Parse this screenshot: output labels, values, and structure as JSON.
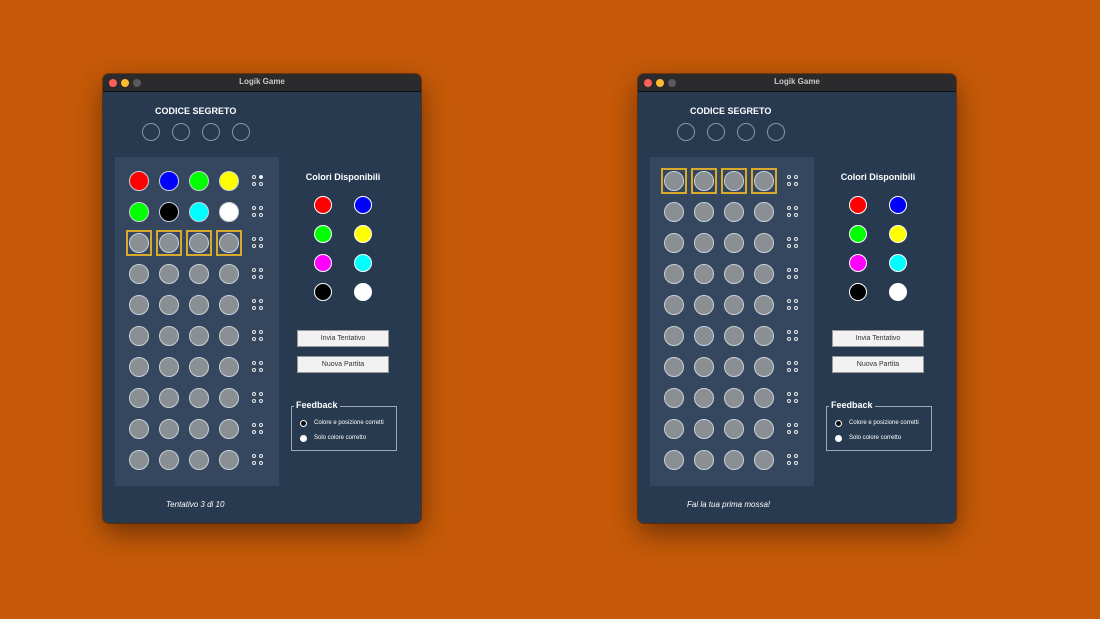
{
  "colors": {
    "hole": "#8a8f93",
    "red": "#ff0000",
    "blue": "#0000ff",
    "green": "#00ff00",
    "yellow": "#ffff00",
    "black": "#000000",
    "cyan": "#00ffff",
    "white": "#ffffff",
    "magenta": "#ff00ff",
    "selection": "#d8a92a"
  },
  "windows": [
    {
      "title": "Logik Game",
      "secret_label": "CODICE SEGRETO",
      "available_title": "Colori Disponibili",
      "available_colors": [
        "red",
        "blue",
        "green",
        "yellow",
        "magenta",
        "cyan",
        "black",
        "white"
      ],
      "buttons": {
        "submit": "Invia Tentativo",
        "new_game": "Nuova Partita"
      },
      "feedback": {
        "legend": "Feedback",
        "exact": "Colore e posizione corretti",
        "color_only": "Solo colore corretto"
      },
      "status": "Tentativo 3 di 10",
      "active_row": 2,
      "rows": [
        {
          "pegs": [
            "red",
            "blue",
            "green",
            "yellow"
          ],
          "feedback": [
            "empty",
            "white",
            "empty",
            "empty"
          ]
        },
        {
          "pegs": [
            "green",
            "black",
            "cyan",
            "white"
          ],
          "feedback": [
            "empty",
            "empty",
            "empty",
            "empty"
          ]
        },
        {
          "pegs": [
            "hole",
            "hole",
            "hole",
            "hole"
          ],
          "feedback": [
            "empty",
            "empty",
            "empty",
            "empty"
          ]
        },
        {
          "pegs": [
            "hole",
            "hole",
            "hole",
            "hole"
          ],
          "feedback": [
            "empty",
            "empty",
            "empty",
            "empty"
          ]
        },
        {
          "pegs": [
            "hole",
            "hole",
            "hole",
            "hole"
          ],
          "feedback": [
            "empty",
            "empty",
            "empty",
            "empty"
          ]
        },
        {
          "pegs": [
            "hole",
            "hole",
            "hole",
            "hole"
          ],
          "feedback": [
            "empty",
            "empty",
            "empty",
            "empty"
          ]
        },
        {
          "pegs": [
            "hole",
            "hole",
            "hole",
            "hole"
          ],
          "feedback": [
            "empty",
            "empty",
            "empty",
            "empty"
          ]
        },
        {
          "pegs": [
            "hole",
            "hole",
            "hole",
            "hole"
          ],
          "feedback": [
            "empty",
            "empty",
            "empty",
            "empty"
          ]
        },
        {
          "pegs": [
            "hole",
            "hole",
            "hole",
            "hole"
          ],
          "feedback": [
            "empty",
            "empty",
            "empty",
            "empty"
          ]
        },
        {
          "pegs": [
            "hole",
            "hole",
            "hole",
            "hole"
          ],
          "feedback": [
            "empty",
            "empty",
            "empty",
            "empty"
          ]
        }
      ]
    },
    {
      "title": "Logik Game",
      "secret_label": "CODICE SEGRETO",
      "available_title": "Colori Disponibili",
      "available_colors": [
        "red",
        "blue",
        "green",
        "yellow",
        "magenta",
        "cyan",
        "black",
        "white"
      ],
      "buttons": {
        "submit": "Invia Tentativo",
        "new_game": "Nuova Partita"
      },
      "feedback": {
        "legend": "Feedback",
        "exact": "Colore e posizione corretti",
        "color_only": "Solo colore corretto"
      },
      "status": "Fai la tua prima mossa!",
      "active_row": 0,
      "rows": [
        {
          "pegs": [
            "hole",
            "hole",
            "hole",
            "hole"
          ],
          "feedback": [
            "empty",
            "empty",
            "empty",
            "empty"
          ]
        },
        {
          "pegs": [
            "hole",
            "hole",
            "hole",
            "hole"
          ],
          "feedback": [
            "empty",
            "empty",
            "empty",
            "empty"
          ]
        },
        {
          "pegs": [
            "hole",
            "hole",
            "hole",
            "hole"
          ],
          "feedback": [
            "empty",
            "empty",
            "empty",
            "empty"
          ]
        },
        {
          "pegs": [
            "hole",
            "hole",
            "hole",
            "hole"
          ],
          "feedback": [
            "empty",
            "empty",
            "empty",
            "empty"
          ]
        },
        {
          "pegs": [
            "hole",
            "hole",
            "hole",
            "hole"
          ],
          "feedback": [
            "empty",
            "empty",
            "empty",
            "empty"
          ]
        },
        {
          "pegs": [
            "hole",
            "hole",
            "hole",
            "hole"
          ],
          "feedback": [
            "empty",
            "empty",
            "empty",
            "empty"
          ]
        },
        {
          "pegs": [
            "hole",
            "hole",
            "hole",
            "hole"
          ],
          "feedback": [
            "empty",
            "empty",
            "empty",
            "empty"
          ]
        },
        {
          "pegs": [
            "hole",
            "hole",
            "hole",
            "hole"
          ],
          "feedback": [
            "empty",
            "empty",
            "empty",
            "empty"
          ]
        },
        {
          "pegs": [
            "hole",
            "hole",
            "hole",
            "hole"
          ],
          "feedback": [
            "empty",
            "empty",
            "empty",
            "empty"
          ]
        },
        {
          "pegs": [
            "hole",
            "hole",
            "hole",
            "hole"
          ],
          "feedback": [
            "empty",
            "empty",
            "empty",
            "empty"
          ]
        }
      ]
    }
  ]
}
